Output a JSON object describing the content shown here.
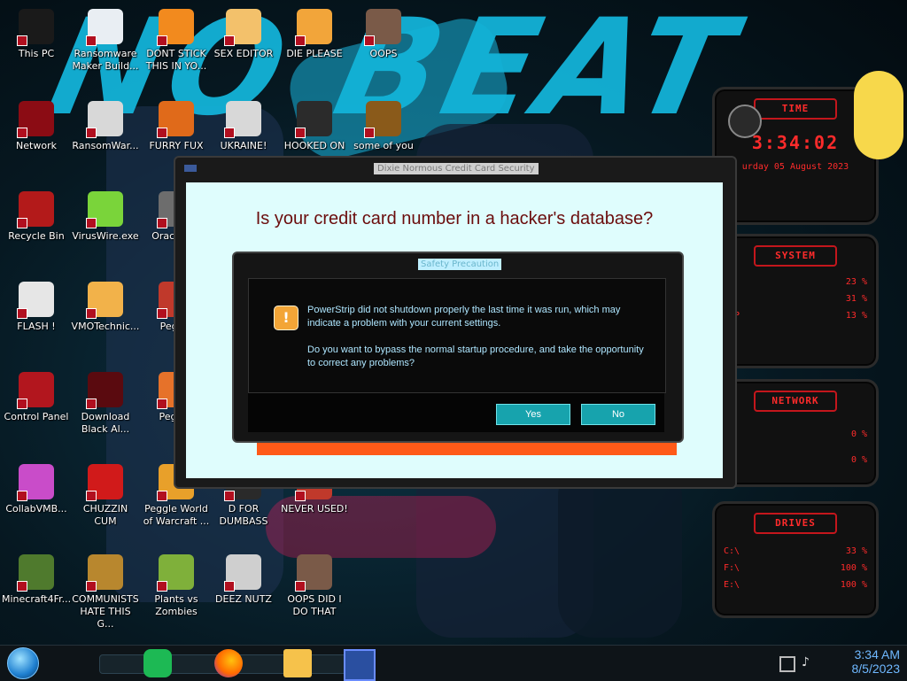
{
  "desktop": {
    "icons": [
      {
        "label": "This PC",
        "color": "#1a1a1a"
      },
      {
        "label": "Ransomware Maker Build...",
        "color": "#e9eef3"
      },
      {
        "label": "DONT STICK THIS IN YO...",
        "color": "#f28a1e"
      },
      {
        "label": "SEX EDITOR",
        "color": "#f3c16b"
      },
      {
        "label": "DIE PLEASE",
        "color": "#f2a53a"
      },
      {
        "label": "OOPS",
        "color": "#7a5a48"
      },
      {
        "label": "Network",
        "color": "#8b0c14"
      },
      {
        "label": "RansomWar...",
        "color": "#d8d8d8"
      },
      {
        "label": "FURRY FUX",
        "color": "#e06a1a"
      },
      {
        "label": "UKRAINE!",
        "color": "#d8d8d8"
      },
      {
        "label": "HOOKED ON",
        "color": "#2b2b2b"
      },
      {
        "label": "some of you",
        "color": "#8a5a1a"
      },
      {
        "label": "Recycle Bin",
        "color": "#b31a1a"
      },
      {
        "label": "VirusWire.exe",
        "color": "#7ad43a"
      },
      {
        "label": "Orac Virtu",
        "color": "#6d6d6d"
      },
      {
        "label": "FLASH !",
        "color": "#e6e6e6"
      },
      {
        "label": "VMOTechnic...",
        "color": "#f2b24a"
      },
      {
        "label": "Peggle",
        "color": "#c0392b"
      },
      {
        "label": "Control Panel",
        "color": "#b2161e"
      },
      {
        "label": "Download Black Al...",
        "color": "#5a0a0f"
      },
      {
        "label": "Pegg D",
        "color": "#e6722a"
      },
      {
        "label": "CollabVMB...",
        "color": "#c94cc9"
      },
      {
        "label": "CHUZZIN CUM",
        "color": "#d11a1a"
      },
      {
        "label": "Peggle World of Warcraft ...",
        "color": "#e8a02a"
      },
      {
        "label": "D FOR DUMBASS",
        "color": "#2a2a2a"
      },
      {
        "label": "NEVER USED!",
        "color": "#c0392b"
      },
      {
        "label": "Minecraft4Fr...",
        "color": "#4f7a2d"
      },
      {
        "label": "COMMUNISTS HATE THIS G...",
        "color": "#b8872e"
      },
      {
        "label": "Plants vs Zombies",
        "color": "#7fb03a"
      },
      {
        "label": "DEEZ NUTZ",
        "color": "#cfcfcf"
      },
      {
        "label": "OOPS DID I DO THAT",
        "color": "#7a5a48"
      }
    ]
  },
  "gadgets": {
    "time": {
      "header": "TIME",
      "clock": "3:34:02",
      "date": "urday 05 August 2023"
    },
    "system": {
      "header": "SYSTEM",
      "rows": [
        {
          "k": "PU",
          "v": "23 %"
        },
        {
          "k": "AM",
          "v": "31 %"
        },
        {
          "k": "WAP",
          "v": "13 %"
        }
      ]
    },
    "network": {
      "header": "NETWORK",
      "rows": [
        {
          "k": "",
          "v": "0 %"
        },
        {
          "k": "T",
          "v": "0 %"
        }
      ]
    },
    "drives": {
      "header": "DRIVES",
      "rows": [
        {
          "k": "C:\\",
          "v": "33 %"
        },
        {
          "k": "F:\\",
          "v": "100 %"
        },
        {
          "k": "E:\\",
          "v": "100 %"
        }
      ]
    }
  },
  "outer_dialog": {
    "title": "Dixie Normous Credit Card Security",
    "headline": "Is your credit card number in a hacker's database?"
  },
  "inner_dialog": {
    "title": "Safety Precaution",
    "message_1": "PowerStrip did not shutdown properly the last time it was run, which may indicate a problem with your current settings.",
    "message_2": "Do you want to bypass the normal startup procedure, and take the opportunity to correct any problems?",
    "yes": "Yes",
    "no": "No"
  },
  "taskbar": {
    "time": "3:34 AM",
    "date": "8/5/2023",
    "apps": [
      "spotify-icon",
      "firefox-icon",
      "file-explorer-icon",
      "credit-card-app-icon"
    ]
  }
}
